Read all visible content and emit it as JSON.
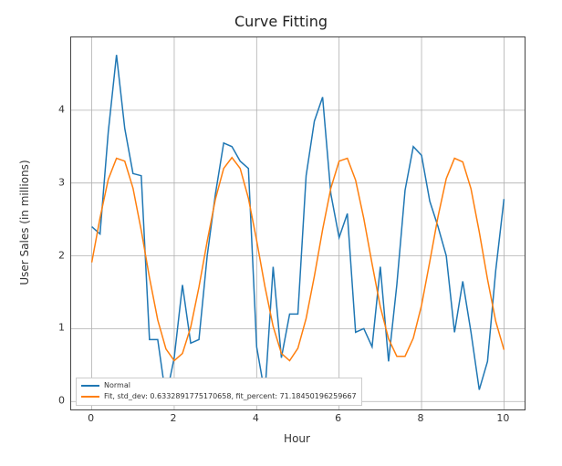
{
  "chart_data": {
    "type": "line",
    "title": "Curve Fitting",
    "xlabel": "Hour",
    "ylabel": "User Sales (in millions)",
    "xlim": [
      -0.5,
      10.5
    ],
    "ylim": [
      -0.11,
      5.0
    ],
    "xticks": [
      0,
      2,
      4,
      6,
      8,
      10
    ],
    "yticks": [
      0,
      1,
      2,
      3,
      4
    ],
    "legend": {
      "position": "lower left",
      "entries": [
        "Normal",
        "Fit, std_dev: 0.6332891775170658, fit_percent: 71.18450196259667"
      ]
    },
    "x": [
      0.0,
      0.2,
      0.4,
      0.6,
      0.8,
      1.0,
      1.2,
      1.4,
      1.6,
      1.8,
      2.0,
      2.2,
      2.4,
      2.6,
      2.8,
      3.0,
      3.2,
      3.4,
      3.6,
      3.8,
      4.0,
      4.2,
      4.4,
      4.6,
      4.8,
      5.0,
      5.2,
      5.4,
      5.6,
      5.8,
      6.0,
      6.2,
      6.4,
      6.6,
      6.8,
      7.0,
      7.2,
      7.4,
      7.6,
      7.8,
      8.0,
      8.2,
      8.4,
      8.6,
      8.8,
      9.0,
      9.2,
      9.4,
      9.6,
      9.8,
      10.0
    ],
    "series": [
      {
        "name": "Normal",
        "values": [
          2.4,
          2.3,
          3.7,
          4.76,
          3.75,
          3.13,
          3.1,
          0.85,
          0.85,
          0.05,
          0.6,
          1.6,
          0.8,
          0.85,
          2.0,
          2.85,
          3.55,
          3.5,
          3.3,
          3.2,
          0.75,
          0.1,
          1.85,
          0.6,
          1.2,
          1.2,
          3.1,
          3.85,
          4.18,
          2.85,
          2.25,
          2.58,
          0.95,
          1.0,
          0.75,
          1.85,
          0.55,
          1.6,
          2.9,
          3.5,
          3.38,
          2.75,
          2.4,
          2.0,
          0.95,
          1.65,
          0.95,
          0.16,
          0.55,
          1.8,
          2.78
        ]
      },
      {
        "name": "Fit",
        "values": [
          1.91,
          2.52,
          3.05,
          3.34,
          3.3,
          2.93,
          2.35,
          1.7,
          1.12,
          0.72,
          0.56,
          0.66,
          1.02,
          1.57,
          2.2,
          2.78,
          3.2,
          3.35,
          3.2,
          2.79,
          2.21,
          1.58,
          1.03,
          0.66,
          0.56,
          0.73,
          1.14,
          1.72,
          2.36,
          2.93,
          3.3,
          3.34,
          3.04,
          2.51,
          1.89,
          1.3,
          0.86,
          0.62,
          0.62,
          0.87,
          1.32,
          1.92,
          2.54,
          3.06,
          3.34,
          3.29,
          2.92,
          2.33,
          1.68,
          1.1,
          0.71
        ]
      }
    ]
  }
}
